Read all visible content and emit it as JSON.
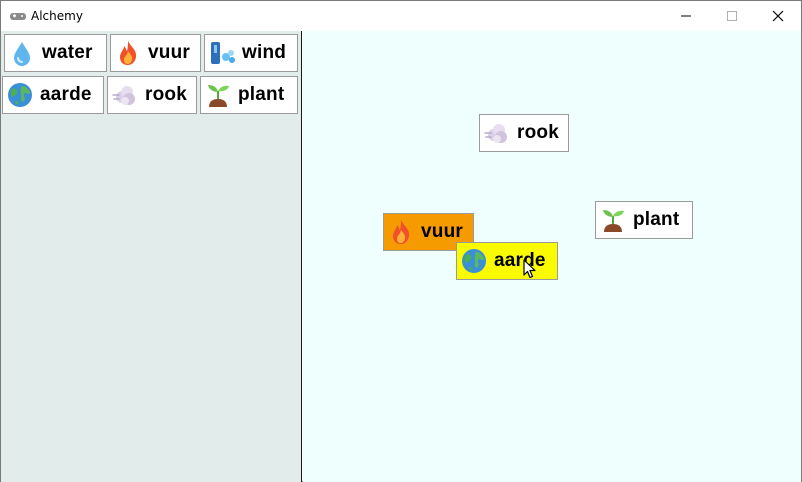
{
  "window": {
    "title": "Alchemy"
  },
  "sidebar": {
    "items": [
      {
        "label": "water",
        "icon": "droplet-icon"
      },
      {
        "label": "vuur",
        "icon": "flame-icon"
      },
      {
        "label": "wind",
        "icon": "wind-icon"
      },
      {
        "label": "aarde",
        "icon": "globe-icon"
      },
      {
        "label": "rook",
        "icon": "smoke-icon"
      },
      {
        "label": "plant",
        "icon": "seedling-icon"
      }
    ]
  },
  "canvas": {
    "items": [
      {
        "label": "rook",
        "icon": "smoke-icon",
        "state": "normal"
      },
      {
        "label": "plant",
        "icon": "seedling-icon",
        "state": "normal"
      },
      {
        "label": "vuur",
        "icon": "flame-icon",
        "state": "highlighted",
        "color": "#f59b00"
      },
      {
        "label": "aarde",
        "icon": "globe-icon",
        "state": "dragging",
        "color": "#fbfb00"
      }
    ]
  },
  "colors": {
    "sidebar_bg": "#e2eceb",
    "canvas_bg": "#effffe"
  }
}
